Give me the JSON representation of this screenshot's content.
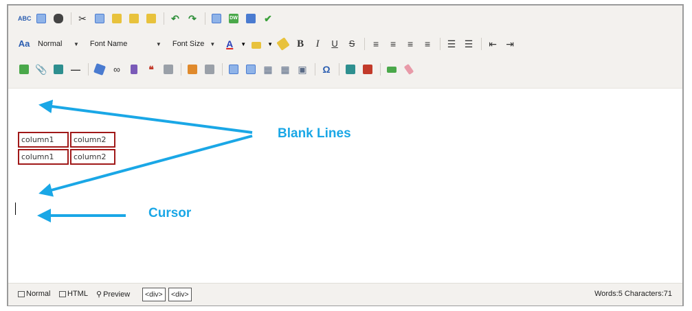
{
  "toolbar": {
    "style_combo": "Normal",
    "font_name_combo": "Font Name",
    "font_size_combo": "Font Size",
    "bold_glyph": "B",
    "italic_glyph": "I",
    "underline_glyph": "U",
    "strike_glyph": "S",
    "omega_glyph": "Ω",
    "dw_label": "DW",
    "font_color_glyph": "A"
  },
  "editor": {
    "table_rows": [
      [
        "column1",
        "column2"
      ],
      [
        "column1",
        "column2"
      ]
    ]
  },
  "annotations": {
    "blank_lines": "Blank Lines",
    "cursor": "Cursor",
    "color": "#1aa7e6"
  },
  "statusbar": {
    "modes": [
      "Normal",
      "HTML",
      "Preview"
    ],
    "tags": [
      "<div>",
      "<div>"
    ],
    "counts": "Words:5 Characters:71"
  }
}
